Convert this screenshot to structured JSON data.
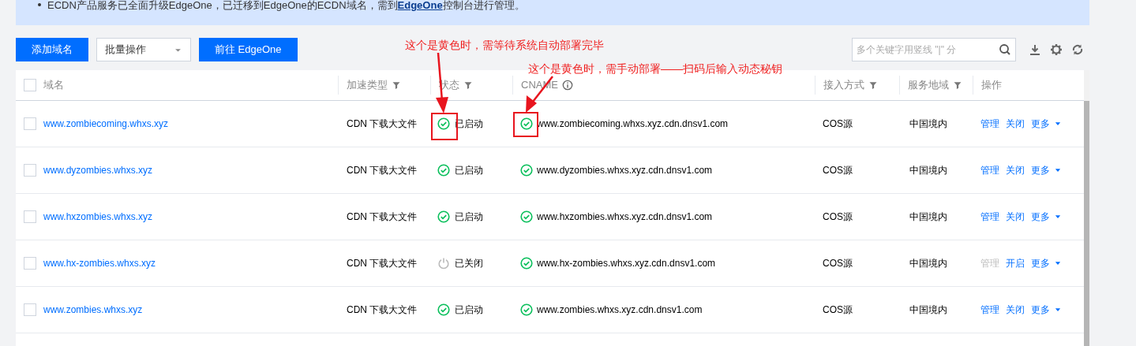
{
  "notice": {
    "before": "ECDN产品服务已全面升级EdgeOne，已迁移到EdgeOne的ECDN域名，需到",
    "link": "EdgeOne",
    "after": "控制台进行管理。"
  },
  "toolbar": {
    "buttons": [
      {
        "label": "添加域名",
        "kind": "primary"
      },
      {
        "label": "批量操作",
        "kind": "select"
      },
      {
        "label": "前往 EdgeOne",
        "kind": "primary"
      }
    ],
    "search": {
      "placeholder": "多个关键字用竖线 \"|\" 分"
    }
  },
  "table": {
    "all_checked": false,
    "columns": [
      {
        "label": "域名",
        "filter": false,
        "info": false
      },
      {
        "label": "加速类型",
        "filter": true,
        "info": false
      },
      {
        "label": "状态",
        "filter": true,
        "info": false
      },
      {
        "label": "CNAME",
        "filter": false,
        "info": true
      },
      {
        "label": "接入方式",
        "filter": true,
        "info": false
      },
      {
        "label": "服务地域",
        "filter": true,
        "info": false
      },
      {
        "label": "操作",
        "filter": false,
        "info": false
      }
    ],
    "rows": [
      {
        "checked": false,
        "domain": "www.zombiecoming.whxs.xyz",
        "type": "CDN 下载大文件",
        "status": {
          "kind": "on",
          "text": "已启动"
        },
        "cname": "www.zombiecoming.whxs.xyz.cdn.dnsv1.com",
        "access": "COS源",
        "region": "中国境内",
        "actions": [
          {
            "label": "管理",
            "disabled": false
          },
          {
            "label": "关闭",
            "disabled": false
          },
          {
            "label": "更多",
            "disabled": false
          }
        ]
      },
      {
        "checked": false,
        "domain": "www.dyzombies.whxs.xyz",
        "type": "CDN 下载大文件",
        "status": {
          "kind": "on",
          "text": "已启动"
        },
        "cname": "www.dyzombies.whxs.xyz.cdn.dnsv1.com",
        "access": "COS源",
        "region": "中国境内",
        "actions": [
          {
            "label": "管理",
            "disabled": false
          },
          {
            "label": "关闭",
            "disabled": false
          },
          {
            "label": "更多",
            "disabled": false
          }
        ]
      },
      {
        "checked": false,
        "domain": "www.hxzombies.whxs.xyz",
        "type": "CDN 下载大文件",
        "status": {
          "kind": "on",
          "text": "已启动"
        },
        "cname": "www.hxzombies.whxs.xyz.cdn.dnsv1.com",
        "access": "COS源",
        "region": "中国境内",
        "actions": [
          {
            "label": "管理",
            "disabled": false
          },
          {
            "label": "关闭",
            "disabled": false
          },
          {
            "label": "更多",
            "disabled": false
          }
        ]
      },
      {
        "checked": false,
        "domain": "www.hx-zombies.whxs.xyz",
        "type": "CDN 下载大文件",
        "status": {
          "kind": "off",
          "text": "已关闭"
        },
        "cname": "www.hx-zombies.whxs.xyz.cdn.dnsv1.com",
        "access": "COS源",
        "region": "中国境内",
        "actions": [
          {
            "label": "管理",
            "disabled": true
          },
          {
            "label": "开启",
            "disabled": false
          },
          {
            "label": "更多",
            "disabled": false
          }
        ]
      },
      {
        "checked": false,
        "domain": "www.zombies.whxs.xyz",
        "type": "CDN 下载大文件",
        "status": {
          "kind": "on",
          "text": "已启动"
        },
        "cname": "www.zombies.whxs.xyz.cdn.dnsv1.com",
        "access": "COS源",
        "region": "中国境内",
        "actions": [
          {
            "label": "管理",
            "disabled": false
          },
          {
            "label": "关闭",
            "disabled": false
          },
          {
            "label": "更多",
            "disabled": false
          }
        ]
      }
    ]
  },
  "annotations": [
    "这个是黄色时，需等待系统自动部署完毕",
    "这个是黄色时，需手动部署——扫码后输入动态秘钥"
  ]
}
